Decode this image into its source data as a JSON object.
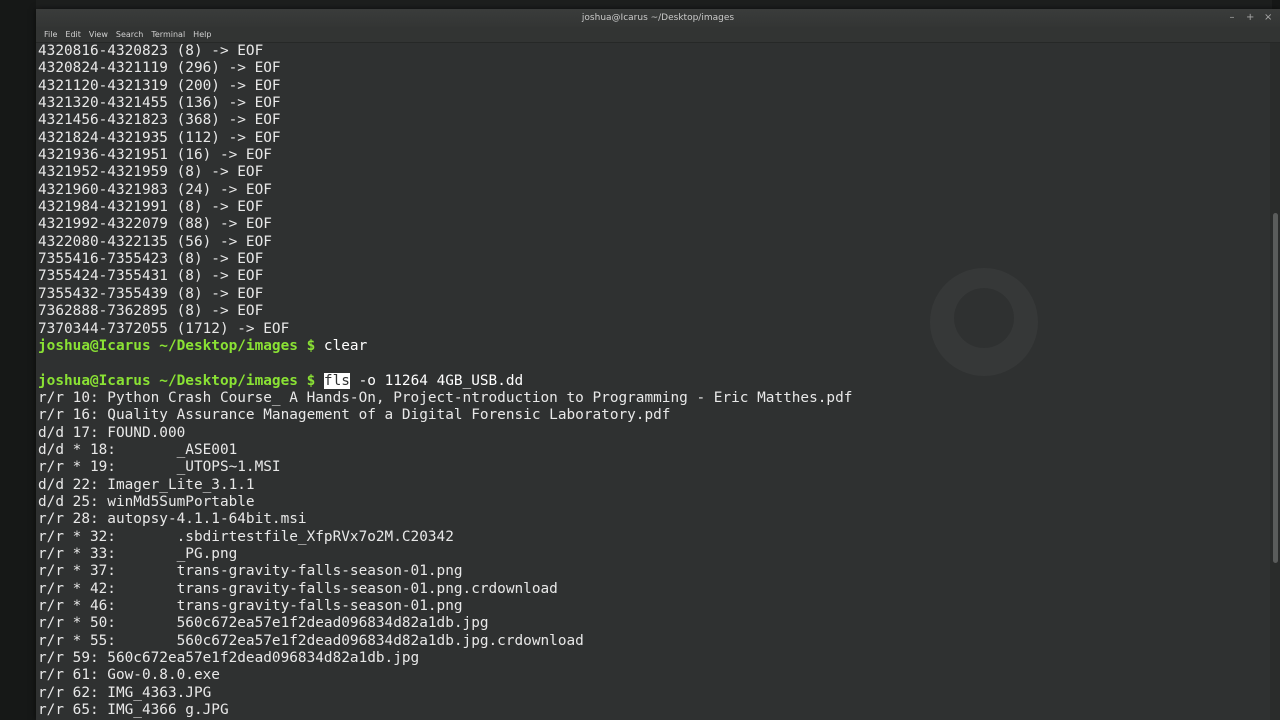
{
  "window": {
    "title": "joshua@Icarus ~/Desktop/images",
    "controls": [
      "–",
      "+",
      "×"
    ]
  },
  "menu": [
    "File",
    "Edit",
    "View",
    "Search",
    "Terminal",
    "Help"
  ],
  "terminal": {
    "lines": [
      {
        "text": "4320816-4320823 (8) -> EOF"
      },
      {
        "text": "4320824-4321119 (296) -> EOF"
      },
      {
        "text": "4321120-4321319 (200) -> EOF"
      },
      {
        "text": "4321320-4321455 (136) -> EOF"
      },
      {
        "text": "4321456-4321823 (368) -> EOF"
      },
      {
        "text": "4321824-4321935 (112) -> EOF"
      },
      {
        "text": "4321936-4321951 (16) -> EOF"
      },
      {
        "text": "4321952-4321959 (8) -> EOF"
      },
      {
        "text": "4321960-4321983 (24) -> EOF"
      },
      {
        "text": "4321984-4321991 (8) -> EOF"
      },
      {
        "text": "4321992-4322079 (88) -> EOF"
      },
      {
        "text": "4322080-4322135 (56) -> EOF"
      },
      {
        "text": "7355416-7355423 (8) -> EOF"
      },
      {
        "text": "7355424-7355431 (8) -> EOF"
      },
      {
        "text": "7355432-7355439 (8) -> EOF"
      },
      {
        "text": "7362888-7362895 (8) -> EOF"
      },
      {
        "text": "7370344-7372055 (1712) -> EOF"
      },
      {
        "prompt": "joshua@Icarus ~/Desktop/images $",
        "cmd": "clear"
      },
      {
        "text": ""
      },
      {
        "prompt": "joshua@Icarus ~/Desktop/images $",
        "cmd_hl": "fls",
        "cmd": "-o 11264 4GB_USB.dd"
      },
      {
        "text": "r/r 10: Python Crash Course_ A Hands-On, Project-ntroduction to Programming - Eric Matthes.pdf"
      },
      {
        "text": "r/r 16: Quality Assurance Management of a Digital Forensic Laboratory.pdf"
      },
      {
        "text": "d/d 17: FOUND.000"
      },
      {
        "text": "d/d * 18:       _ASE001"
      },
      {
        "text": "r/r * 19:       _UTOPS~1.MSI"
      },
      {
        "text": "d/d 22: Imager_Lite_3.1.1"
      },
      {
        "text": "d/d 25: winMd5SumPortable"
      },
      {
        "text": "r/r 28: autopsy-4.1.1-64bit.msi"
      },
      {
        "text": "r/r * 32:       .sbdirtestfile_XfpRVx7o2M.C20342"
      },
      {
        "text": "r/r * 33:       _PG.png"
      },
      {
        "text": "r/r * 37:       trans-gravity-falls-season-01.png"
      },
      {
        "text": "r/r * 42:       trans-gravity-falls-season-01.png.crdownload"
      },
      {
        "text": "r/r * 46:       trans-gravity-falls-season-01.png"
      },
      {
        "text": "r/r * 50:       560c672ea57e1f2dead096834d82a1db.jpg"
      },
      {
        "text": "r/r * 55:       560c672ea57e1f2dead096834d82a1db.jpg.crdownload"
      },
      {
        "text": "r/r 59: 560c672ea57e1f2dead096834d82a1db.jpg"
      },
      {
        "text": "r/r 61: Gow-0.8.0.exe"
      },
      {
        "text": "r/r 62: IMG_4363.JPG"
      },
      {
        "text": "r/r 65: IMG_4366 g.JPG"
      }
    ]
  },
  "colors": {
    "prompt": "#8ae234",
    "background": "#2f3131",
    "text": "#e8e8e8"
  }
}
